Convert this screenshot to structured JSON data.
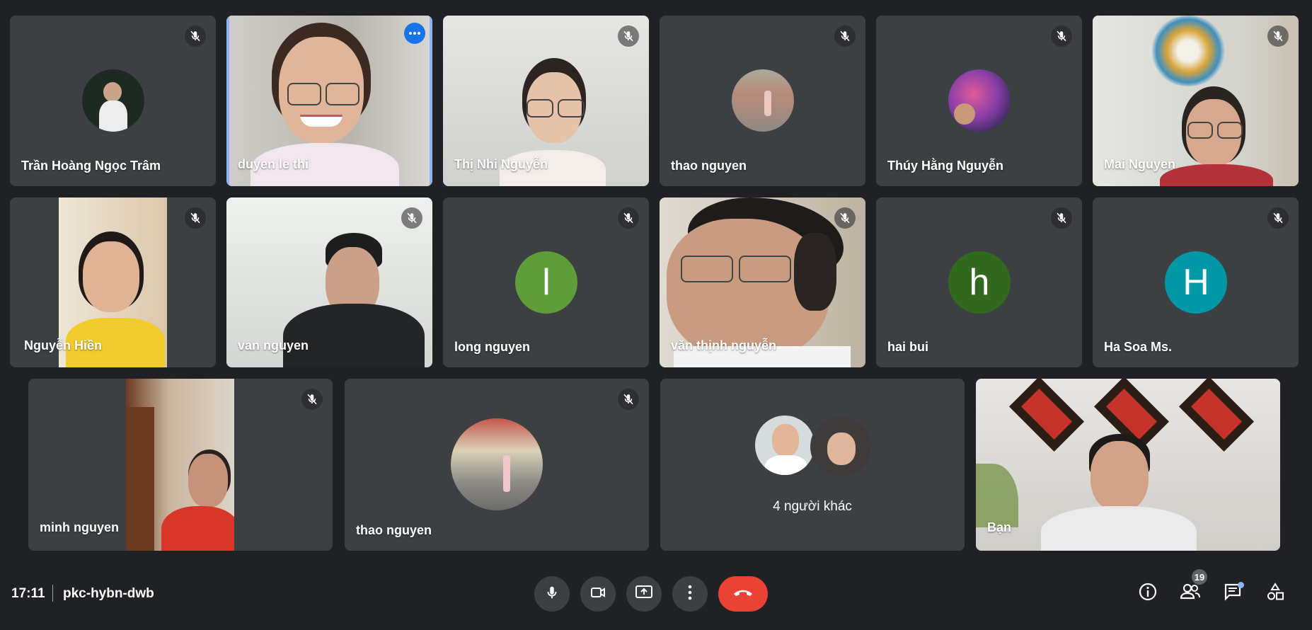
{
  "participants": [
    {
      "name": "Trần Hoàng Ngọc Trâm"
    },
    {
      "name": "duyen le thi"
    },
    {
      "name": "Thị Nhi Nguyễn"
    },
    {
      "name": "thao nguyen"
    },
    {
      "name": "Thúy Hằng Nguyễn"
    },
    {
      "name": "Mai Nguyen"
    },
    {
      "name": "Nguyễn Hiền"
    },
    {
      "name": "van nguyen"
    },
    {
      "name": "long nguyen",
      "initial": "l",
      "color": "#5e9e3a"
    },
    {
      "name": "văn thịnh nguyễn"
    },
    {
      "name": "hai bui",
      "initial": "h",
      "color": "#33691e"
    },
    {
      "name": "Ha Soa Ms.",
      "initial": "H",
      "color": "#0097a7"
    },
    {
      "name": "minh nguyen"
    },
    {
      "name": "thao nguyen"
    },
    {
      "name": "Bạn"
    }
  ],
  "others_tile": {
    "label": "4 người khác"
  },
  "bottom_bar": {
    "time": "17:11",
    "meeting_code": "pkc-hybn-dwb",
    "participants_count": "19"
  },
  "colors": {
    "background": "#202124",
    "tile": "#3c4043",
    "end_call": "#ea4335",
    "active_border": "#8ab4f8"
  }
}
